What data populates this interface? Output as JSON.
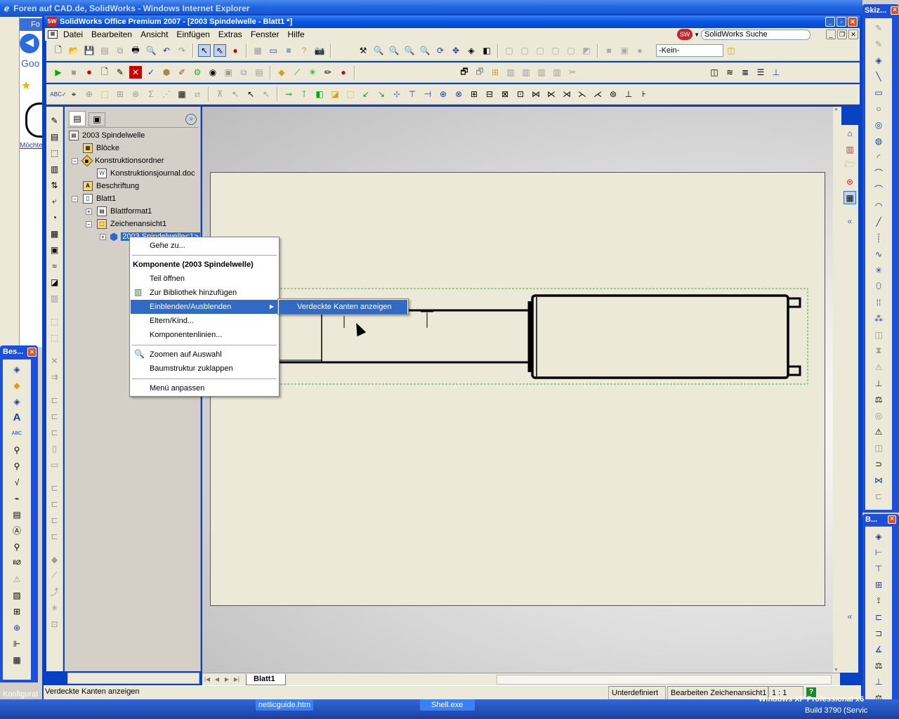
{
  "ie": {
    "title": "Foren auf CAD.de, SolidWorks - Windows Internet Explorer",
    "tab_partial": "Fo",
    "google_partial": "Goo",
    "side_text": "Möchte"
  },
  "app": {
    "title": "SolidWorks Office Premium 2007 - [2003 Spindelwelle - Blatt1 *]",
    "menus": [
      "Datei",
      "Bearbeiten",
      "Ansicht",
      "Einfügen",
      "Extras",
      "Fenster",
      "Hilfe"
    ],
    "search_label": "SolidWorks Suche",
    "config_value": "-Kein-"
  },
  "tree": {
    "root": "2003 Spindelwelle",
    "items": [
      "Blöcke",
      "Konstruktionsordner",
      "Konstruktionsjournal.doc",
      "Beschriftung",
      "Blatt1",
      "Blattformat1",
      "Zeichenansicht1",
      "2003 Spindelwelle<1>"
    ]
  },
  "context_menu": {
    "goto": "Gehe zu...",
    "header": "Komponente (2003 Spindelwelle)",
    "open_part": "Teil öffnen",
    "add_library": "Zur Bibliothek hinzufügen",
    "show_hide": "Einblenden/Ausblenden",
    "parent_child": "Eltern/Kind...",
    "component_lines": "Komponentenlinien...",
    "zoom_selection": "Zoomen auf Auswahl",
    "collapse_tree": "Baumstruktur zuklappen",
    "customize_menu": "Menü anpassen",
    "submenu_item": "Verdeckte Kanten anzeigen"
  },
  "sheet_tab": "Blatt1",
  "status": {
    "message": "Verdeckte Kanten anzeigen",
    "state": "Unterdefiniert",
    "editing": "Bearbeiten Zeichenansicht1",
    "scale": "1 : 1",
    "help": "?"
  },
  "panels": {
    "left_title": "Bes...",
    "right_title": "Skiz...",
    "right2_title": "B...",
    "config_partial": "Konfigurat"
  },
  "taskbar": {
    "items": [
      "netlicguide.htm",
      "Shell.exe"
    ],
    "os_text": "Windows XP Professional x6",
    "build": "Build 3790 (Servic"
  }
}
